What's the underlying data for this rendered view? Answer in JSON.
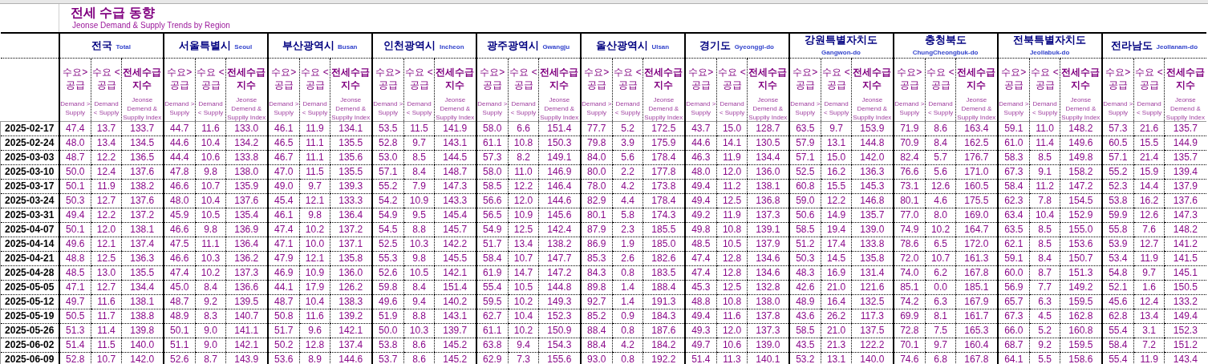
{
  "title": "전세 수급 동향",
  "subtitle": "Jeonse Demand & Supply Trends by Region",
  "regions": [
    {
      "name": "전국",
      "name_en": "Total",
      "columns": [
        {
          "kind": "over",
          "label": "수요> 공급",
          "label_en": "Demand > Supply"
        },
        {
          "kind": "under",
          "label": "수요 <공급",
          "label_en": "Demand < Supply"
        },
        {
          "kind": "index",
          "label": "전세수급 지수",
          "label_en": "Jeonse Demend & Supplly Index"
        }
      ]
    },
    {
      "name": "서울특별시",
      "name_en": "Seoul",
      "columns": [
        {
          "kind": "over",
          "label": "수요> 공급",
          "label_en": "Demand > Supply"
        },
        {
          "kind": "under",
          "label": "수요 <공급",
          "label_en": "Demand < Supply"
        },
        {
          "kind": "index",
          "label": "전세수급 지수",
          "label_en": "Jeonse Demend & Supplly Index"
        }
      ]
    },
    {
      "name": "부산광역시",
      "name_en": "Busan",
      "columns": [
        {
          "kind": "over",
          "label": "수요> 공급",
          "label_en": "Demand > Supply"
        },
        {
          "kind": "under",
          "label": "수요 <공급",
          "label_en": "Demand < Supply"
        },
        {
          "kind": "index",
          "label": "전세수급 지수",
          "label_en": "Jeonse Demend & Supplly Index"
        }
      ]
    },
    {
      "name": "인천광역시",
      "name_en": "Incheon",
      "columns": [
        {
          "kind": "over",
          "label": "수요> 공급",
          "label_en": "Demand > Supply"
        },
        {
          "kind": "under",
          "label": "수요 <공급",
          "label_en": "Demand < Supply"
        },
        {
          "kind": "index",
          "label": "전세수급 지수",
          "label_en": "Jeonse Demend & Supplly Index"
        }
      ]
    },
    {
      "name": "광주광역시",
      "name_en": "Gwangju",
      "columns": [
        {
          "kind": "over",
          "label": "수요> 공급",
          "label_en": "Demand > Supply"
        },
        {
          "kind": "under",
          "label": "수요 <공급",
          "label_en": "Demand < Supply"
        },
        {
          "kind": "index",
          "label": "전세수급 지수",
          "label_en": "Jeonse Demend & Supplly Index"
        }
      ]
    },
    {
      "name": "울산광역시",
      "name_en": "Ulsan",
      "columns": [
        {
          "kind": "over",
          "label": "수요> 공급",
          "label_en": "Demand > Supply"
        },
        {
          "kind": "under",
          "label": "수요 <공급",
          "label_en": "Demand < Supply"
        },
        {
          "kind": "index",
          "label": "전세수급 지수",
          "label_en": "Jeonse Demend & Supplly Index"
        }
      ]
    },
    {
      "name": "경기도",
      "name_en": "Gyeonggi-do",
      "columns": [
        {
          "kind": "over",
          "label": "수요> 공급",
          "label_en": "Demand > Supply"
        },
        {
          "kind": "under",
          "label": "수요 <공급",
          "label_en": "Demand < Supply"
        },
        {
          "kind": "index",
          "label": "전세수급 지수",
          "label_en": "Jeonse Demend & Supplly Index"
        }
      ]
    },
    {
      "name": "강원특별자치도",
      "name_en": "Gangwon-do",
      "columns": [
        {
          "kind": "over",
          "label": "수요> 공급",
          "label_en": "Demand > Supply"
        },
        {
          "kind": "under",
          "label": "수요 <공급",
          "label_en": "Demand < Supply"
        },
        {
          "kind": "index",
          "label": "전세수급 지수",
          "label_en": "Jeonse Demend & Supplly Index"
        }
      ]
    },
    {
      "name": "충청북도",
      "name_en": "ChungCheongbuk-do",
      "columns": [
        {
          "kind": "over",
          "label": "수요> 공급",
          "label_en": "Demand > Supply"
        },
        {
          "kind": "under",
          "label": "수요 <공급",
          "label_en": "Demand < Supply"
        },
        {
          "kind": "index",
          "label": "전세수급 지수",
          "label_en": "Jeonse Demend & Supplly Index"
        }
      ]
    },
    {
      "name": "전북특별자치도",
      "name_en": "Jeollabuk-do",
      "columns": [
        {
          "kind": "over",
          "label": "수요> 공급",
          "label_en": "Demand > Supply"
        },
        {
          "kind": "under",
          "label": "수요 <공급",
          "label_en": "Demand < Supply"
        },
        {
          "kind": "index",
          "label": "전세수급 지수",
          "label_en": "Jeonse Demend & Supplly Index"
        }
      ]
    },
    {
      "name": "전라남도",
      "name_en": "Jeollanam-do",
      "columns": [
        {
          "kind": "over",
          "label": "수요> 공급",
          "label_en": "Demand > Supply"
        },
        {
          "kind": "under",
          "label": "수요 <공급",
          "label_en": "Demand < Supply"
        },
        {
          "kind": "index",
          "label": "전세수급 지수",
          "label_en": "Jeonse Demend & Supplly Index"
        }
      ]
    }
  ],
  "rows": [
    {
      "date": "2025-02-17",
      "values": [
        "47.4",
        "13.7",
        "133.7",
        "44.7",
        "11.6",
        "133.0",
        "46.1",
        "11.9",
        "134.1",
        "53.5",
        "11.5",
        "141.9",
        "58.0",
        "6.6",
        "151.4",
        "77.7",
        "5.2",
        "172.5",
        "43.7",
        "15.0",
        "128.7",
        "63.5",
        "9.7",
        "153.9",
        "71.9",
        "8.6",
        "163.4",
        "59.1",
        "11.0",
        "148.2",
        "57.3",
        "21.6",
        "135.7"
      ]
    },
    {
      "date": "2025-02-24",
      "values": [
        "48.0",
        "13.4",
        "134.5",
        "44.6",
        "10.4",
        "134.2",
        "46.5",
        "11.1",
        "135.5",
        "52.8",
        "9.7",
        "143.1",
        "61.1",
        "10.8",
        "150.3",
        "79.8",
        "3.9",
        "175.9",
        "44.6",
        "14.1",
        "130.5",
        "57.9",
        "13.1",
        "144.8",
        "70.9",
        "8.4",
        "162.5",
        "61.0",
        "11.4",
        "149.6",
        "60.5",
        "15.5",
        "144.9"
      ]
    },
    {
      "date": "2025-03-03",
      "values": [
        "48.7",
        "12.2",
        "136.5",
        "44.4",
        "10.6",
        "133.8",
        "46.7",
        "11.1",
        "135.6",
        "53.0",
        "8.5",
        "144.5",
        "57.3",
        "8.2",
        "149.1",
        "84.0",
        "5.6",
        "178.4",
        "46.3",
        "11.9",
        "134.4",
        "57.1",
        "15.0",
        "142.0",
        "82.4",
        "5.7",
        "176.7",
        "58.3",
        "8.5",
        "149.8",
        "57.1",
        "21.4",
        "135.7"
      ]
    },
    {
      "date": "2025-03-10",
      "values": [
        "50.0",
        "12.4",
        "137.6",
        "47.8",
        "9.8",
        "138.0",
        "47.0",
        "11.5",
        "135.5",
        "57.1",
        "8.4",
        "148.7",
        "58.0",
        "11.0",
        "146.9",
        "80.0",
        "2.2",
        "177.8",
        "48.0",
        "12.0",
        "136.0",
        "52.5",
        "16.2",
        "136.3",
        "76.6",
        "5.6",
        "171.0",
        "67.3",
        "9.1",
        "158.2",
        "55.2",
        "15.9",
        "139.4"
      ]
    },
    {
      "date": "2025-03-17",
      "values": [
        "50.1",
        "11.9",
        "138.2",
        "46.6",
        "10.7",
        "135.9",
        "49.0",
        "9.7",
        "139.3",
        "55.2",
        "7.9",
        "147.3",
        "58.5",
        "12.2",
        "146.4",
        "78.0",
        "4.2",
        "173.8",
        "49.4",
        "11.2",
        "138.1",
        "60.8",
        "15.5",
        "145.3",
        "73.1",
        "12.6",
        "160.5",
        "58.4",
        "11.2",
        "147.2",
        "52.3",
        "14.4",
        "137.9"
      ]
    },
    {
      "date": "2025-03-24",
      "values": [
        "50.3",
        "12.7",
        "137.6",
        "48.0",
        "10.4",
        "137.6",
        "45.4",
        "12.1",
        "133.3",
        "54.2",
        "10.9",
        "143.3",
        "56.6",
        "12.0",
        "144.6",
        "82.9",
        "4.4",
        "178.4",
        "49.4",
        "12.5",
        "136.8",
        "59.0",
        "12.2",
        "146.8",
        "80.1",
        "4.6",
        "175.5",
        "62.3",
        "7.8",
        "154.5",
        "53.8",
        "16.2",
        "137.6"
      ]
    },
    {
      "date": "2025-03-31",
      "values": [
        "49.4",
        "12.2",
        "137.2",
        "45.9",
        "10.5",
        "135.4",
        "46.1",
        "9.8",
        "136.4",
        "54.9",
        "9.5",
        "145.4",
        "56.5",
        "10.9",
        "145.6",
        "80.1",
        "5.8",
        "174.3",
        "49.2",
        "11.9",
        "137.3",
        "50.6",
        "14.9",
        "135.7",
        "77.0",
        "8.0",
        "169.0",
        "63.4",
        "10.4",
        "152.9",
        "59.9",
        "12.6",
        "147.3"
      ]
    },
    {
      "date": "2025-04-07",
      "values": [
        "50.1",
        "12.0",
        "138.1",
        "46.6",
        "9.8",
        "136.9",
        "47.4",
        "10.2",
        "137.2",
        "54.5",
        "8.8",
        "145.7",
        "54.9",
        "12.5",
        "142.4",
        "87.9",
        "2.3",
        "185.5",
        "49.8",
        "10.8",
        "139.1",
        "58.5",
        "19.4",
        "139.0",
        "74.9",
        "10.2",
        "164.7",
        "63.5",
        "8.5",
        "155.0",
        "55.8",
        "7.6",
        "148.2"
      ]
    },
    {
      "date": "2025-04-14",
      "values": [
        "49.6",
        "12.1",
        "137.4",
        "47.5",
        "11.1",
        "136.4",
        "47.1",
        "10.0",
        "137.1",
        "52.5",
        "10.3",
        "142.2",
        "51.7",
        "13.4",
        "138.2",
        "86.9",
        "1.9",
        "185.0",
        "48.5",
        "10.5",
        "137.9",
        "51.2",
        "17.4",
        "133.8",
        "78.6",
        "6.5",
        "172.0",
        "62.1",
        "8.5",
        "153.6",
        "53.9",
        "12.7",
        "141.2"
      ]
    },
    {
      "date": "2025-04-21",
      "values": [
        "48.8",
        "12.5",
        "136.3",
        "46.6",
        "10.3",
        "136.2",
        "47.9",
        "12.1",
        "135.8",
        "55.3",
        "9.8",
        "145.5",
        "58.4",
        "10.7",
        "147.7",
        "85.3",
        "2.6",
        "182.6",
        "47.4",
        "12.8",
        "134.6",
        "50.3",
        "14.5",
        "135.8",
        "72.0",
        "10.7",
        "161.3",
        "59.1",
        "8.4",
        "150.7",
        "53.4",
        "11.9",
        "141.5"
      ]
    },
    {
      "date": "2025-04-28",
      "values": [
        "48.5",
        "13.0",
        "135.5",
        "47.4",
        "10.2",
        "137.3",
        "46.9",
        "10.9",
        "136.0",
        "52.6",
        "10.5",
        "142.1",
        "61.9",
        "14.7",
        "147.2",
        "84.3",
        "0.8",
        "183.5",
        "47.4",
        "12.8",
        "134.6",
        "48.3",
        "16.9",
        "131.4",
        "74.0",
        "6.2",
        "167.8",
        "60.0",
        "8.7",
        "151.3",
        "54.8",
        "9.7",
        "145.1"
      ]
    },
    {
      "date": "2025-05-05",
      "values": [
        "47.1",
        "12.7",
        "134.4",
        "45.0",
        "8.4",
        "136.6",
        "44.1",
        "17.9",
        "126.2",
        "59.8",
        "8.4",
        "151.4",
        "55.4",
        "10.5",
        "144.8",
        "89.8",
        "1.4",
        "188.4",
        "45.3",
        "12.5",
        "132.8",
        "42.6",
        "21.0",
        "121.6",
        "85.1",
        "0.0",
        "185.1",
        "56.9",
        "7.7",
        "149.2",
        "52.1",
        "1.6",
        "150.5"
      ]
    },
    {
      "date": "2025-05-12",
      "values": [
        "49.7",
        "11.6",
        "138.1",
        "48.7",
        "9.2",
        "139.5",
        "48.7",
        "10.4",
        "138.3",
        "49.6",
        "9.4",
        "140.2",
        "59.5",
        "10.2",
        "149.3",
        "92.7",
        "1.4",
        "191.3",
        "48.8",
        "10.8",
        "138.0",
        "48.9",
        "16.4",
        "132.5",
        "74.2",
        "6.3",
        "167.9",
        "65.7",
        "6.3",
        "159.5",
        "45.6",
        "12.4",
        "133.2"
      ]
    },
    {
      "date": "2025-05-19",
      "values": [
        "50.5",
        "11.7",
        "138.8",
        "48.9",
        "8.3",
        "140.7",
        "50.8",
        "11.6",
        "139.2",
        "51.9",
        "8.8",
        "143.1",
        "62.7",
        "10.4",
        "152.3",
        "85.2",
        "0.9",
        "184.3",
        "49.4",
        "11.6",
        "137.8",
        "43.6",
        "26.2",
        "117.3",
        "69.9",
        "8.1",
        "161.7",
        "67.3",
        "4.5",
        "162.8",
        "62.8",
        "13.4",
        "149.4"
      ]
    },
    {
      "date": "2025-05-26",
      "values": [
        "51.3",
        "11.4",
        "139.8",
        "50.1",
        "9.0",
        "141.1",
        "51.7",
        "9.6",
        "142.1",
        "50.0",
        "10.3",
        "139.7",
        "61.1",
        "10.2",
        "150.9",
        "88.4",
        "0.8",
        "187.6",
        "49.3",
        "12.0",
        "137.3",
        "58.5",
        "21.0",
        "137.5",
        "72.8",
        "7.5",
        "165.3",
        "66.0",
        "5.2",
        "160.8",
        "55.4",
        "3.1",
        "152.3"
      ]
    },
    {
      "date": "2025-06-02",
      "values": [
        "51.4",
        "11.5",
        "140.0",
        "51.1",
        "9.0",
        "142.1",
        "50.2",
        "12.8",
        "137.4",
        "53.8",
        "8.6",
        "145.2",
        "63.8",
        "9.4",
        "154.3",
        "88.4",
        "4.2",
        "184.2",
        "49.7",
        "10.6",
        "139.0",
        "43.5",
        "21.3",
        "122.2",
        "70.1",
        "9.7",
        "160.4",
        "68.7",
        "9.2",
        "159.5",
        "58.4",
        "7.2",
        "151.2"
      ]
    },
    {
      "date": "2025-06-09",
      "values": [
        "52.8",
        "10.7",
        "142.0",
        "52.6",
        "8.7",
        "143.9",
        "53.6",
        "8.9",
        "144.6",
        "53.7",
        "8.6",
        "145.2",
        "62.9",
        "7.3",
        "155.6",
        "93.0",
        "0.8",
        "192.2",
        "51.4",
        "11.3",
        "140.1",
        "53.2",
        "13.1",
        "140.0",
        "74.6",
        "6.8",
        "167.8",
        "64.1",
        "5.5",
        "158.6",
        "55.4",
        "11.9",
        "143.4"
      ]
    }
  ]
}
